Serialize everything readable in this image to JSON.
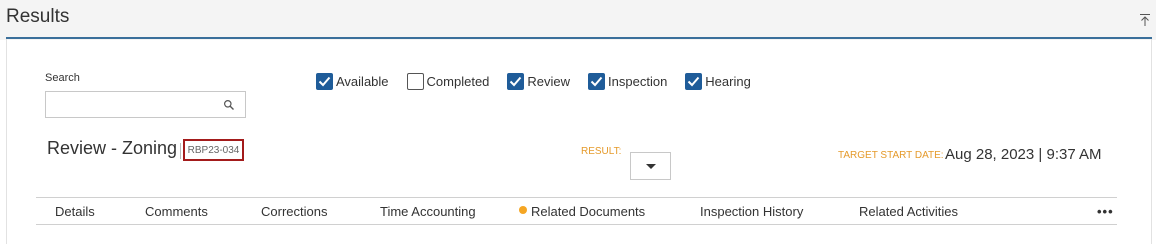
{
  "section": {
    "title": "Results"
  },
  "search": {
    "label": "Search",
    "value": "",
    "placeholder": ""
  },
  "filters": [
    {
      "label": "Available",
      "checked": true
    },
    {
      "label": "Completed",
      "checked": false
    },
    {
      "label": "Review",
      "checked": true
    },
    {
      "label": "Inspection",
      "checked": true
    },
    {
      "label": "Hearing",
      "checked": true
    }
  ],
  "record": {
    "title": "Review - Zoning",
    "id": "RBP23-034",
    "result_label": "RESULT:",
    "result_value": "",
    "target_start_label": "TARGET START DATE:",
    "target_start_value": "Aug 28, 2023 | 9:37 AM"
  },
  "tabs": [
    {
      "label": "Details"
    },
    {
      "label": "Comments"
    },
    {
      "label": "Corrections"
    },
    {
      "label": "Time Accounting"
    },
    {
      "label": "Related Documents",
      "indicator": true
    },
    {
      "label": "Inspection History"
    },
    {
      "label": "Related Activities"
    }
  ],
  "more_label": "•••",
  "colors": {
    "accent_blue": "#1f5c99",
    "header_rule": "#3a6f9a",
    "label_orange": "#e59a2b",
    "indicator_orange": "#f5a623",
    "id_border_red": "#a31b1b"
  }
}
